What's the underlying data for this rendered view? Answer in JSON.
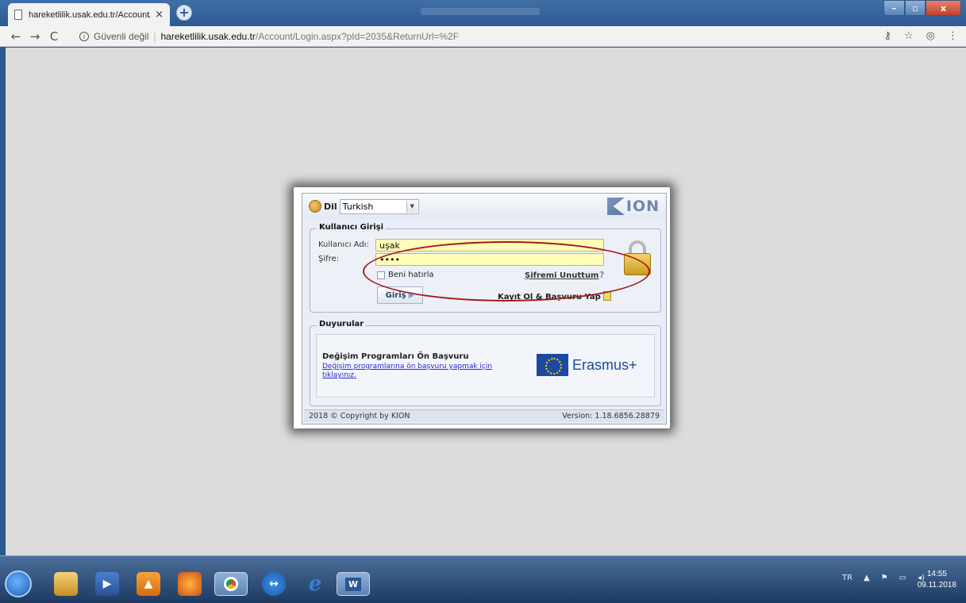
{
  "browser": {
    "tab_title": "hareketlilik.usak.edu.tr/Account/",
    "tab_close": "×",
    "newtab": "+",
    "security": "Güvenli değil",
    "url_host": "hareketlilik.usak.edu.tr",
    "url_path": "/Account/Login.aspx?pId=2035&ReturnUrl=%2F",
    "back": "←",
    "forward": "→",
    "reload": "C",
    "min": "–",
    "max": "▫",
    "close": "x"
  },
  "panel": {
    "lang_label": "Dil",
    "lang_value": "Turkish",
    "logo_text": "ION",
    "login_group_title": "Kullanıcı Girişi",
    "username_label": "Kullanıcı Adı:",
    "username_value": "uşak",
    "password_label": "Şifre:",
    "password_value": "••••",
    "remember_label": "Beni hatırla",
    "forgot_label": "Şifremi Unuttum",
    "login_button": "Giriş",
    "register_label": "Kayıt Ol & Başvuru Yap",
    "news_group_title": "Duyurular",
    "news_title": "Değişim Programları Ön Başvuru",
    "news_link": "Değişim programlarına ön başvuru yapmak için tıklayınız.",
    "erasmus_text": "Erasmus+",
    "copyright": "2018 © Copyright by KION",
    "version": "Version: 1.18.6856.28879"
  },
  "taskbar": {
    "lang": "TR",
    "time": "14:55",
    "date": "09.11.2018"
  },
  "colors": {
    "field_bg": "#fffdb8",
    "highlight_ellipse": "#a51a1a",
    "page_bg": "#dcdcdc"
  }
}
